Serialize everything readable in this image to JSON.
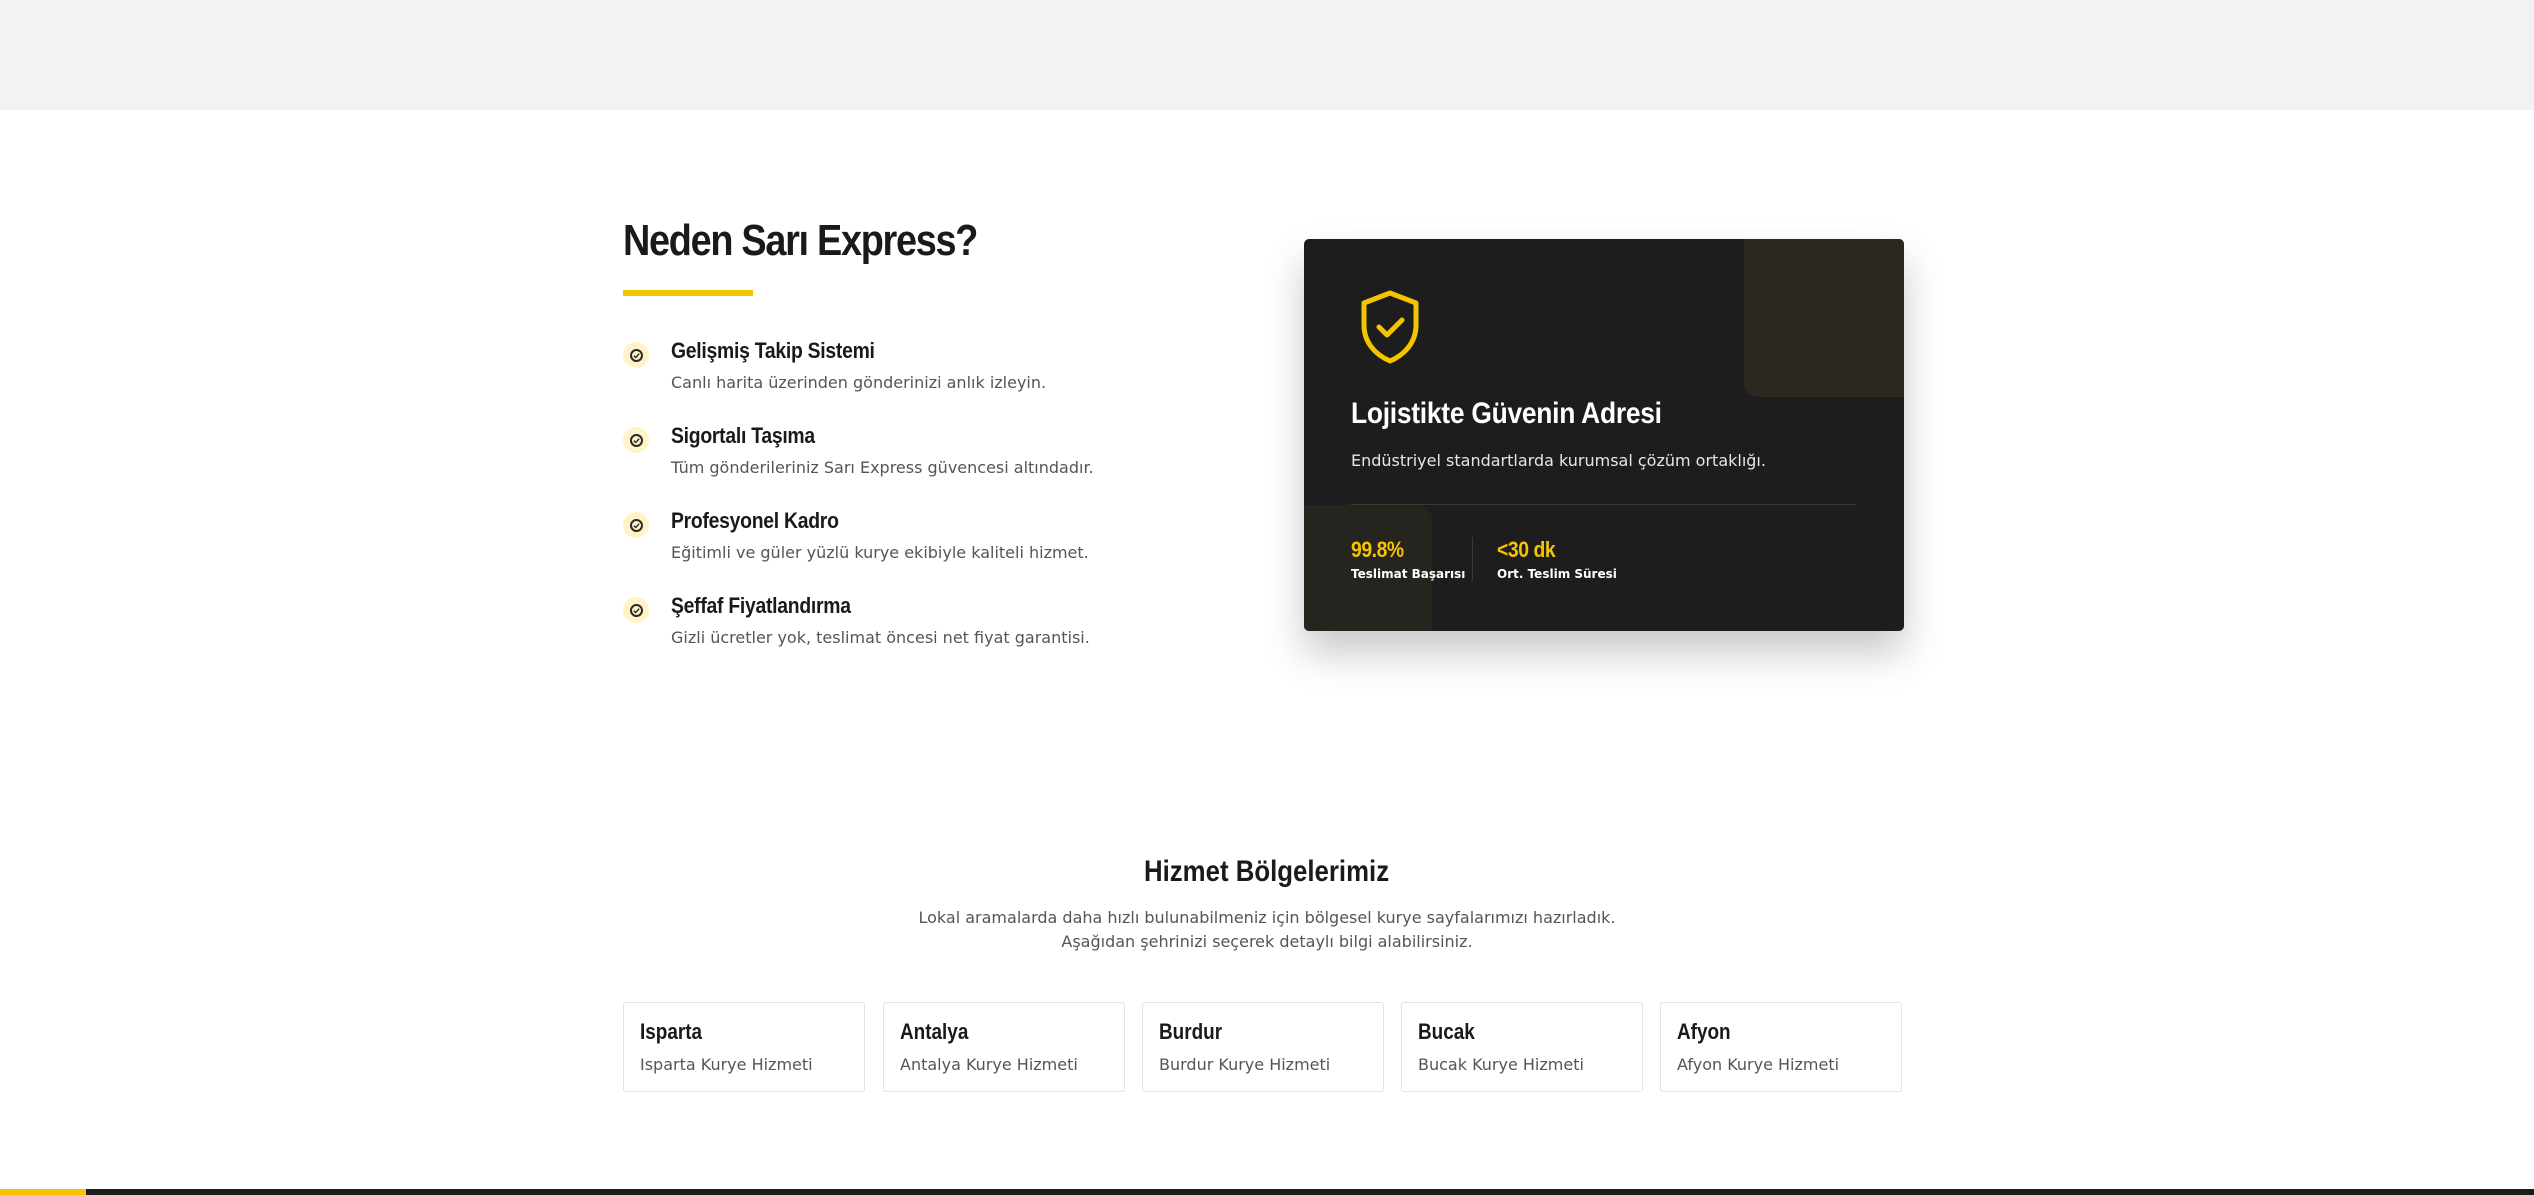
{
  "why": {
    "title": "Neden Sarı Express?",
    "features": [
      {
        "title": "Gelişmiş Takip Sistemi",
        "desc": "Canlı harita üzerinden gönderinizi anlık izleyin."
      },
      {
        "title": "Sigortalı Taşıma",
        "desc": "Tüm gönderileriniz Sarı Express güvencesi altındadır."
      },
      {
        "title": "Profesyonel Kadro",
        "desc": "Eğitimli ve güler yüzlü kurye ekibiyle kaliteli hizmet."
      },
      {
        "title": "Şeffaf Fiyatlandırma",
        "desc": "Gizli ücretler yok, teslimat öncesi net fiyat garantisi."
      }
    ]
  },
  "trust_card": {
    "icon": "shield-check-icon",
    "title": "Lojistikte Güvenin Adresi",
    "subtitle": "Endüstriyel standartlarda kurumsal çözüm ortaklığı.",
    "stats": [
      {
        "value": "99.8%",
        "label": "Teslimat Başarısı"
      },
      {
        "value": "<30 dk",
        "label": "Ort. Teslim Süresi"
      }
    ]
  },
  "regions": {
    "title": "Hizmet Bölgelerimiz",
    "description": "Lokal aramalarda daha hızlı bulunabilmeniz için bölgesel kurye sayfalarımızı hazırladık. Aşağıdan şehrinizi seçerek detaylı bilgi alabilirsiniz.",
    "items": [
      {
        "name": "Isparta",
        "service": "Isparta Kurye Hizmeti"
      },
      {
        "name": "Antalya",
        "service": "Antalya Kurye Hizmeti"
      },
      {
        "name": "Burdur",
        "service": "Burdur Kurye Hizmeti"
      },
      {
        "name": "Bucak",
        "service": "Bucak Kurye Hizmeti"
      },
      {
        "name": "Afyon",
        "service": "Afyon Kurye Hizmeti"
      }
    ]
  },
  "colors": {
    "accent": "#f5c400",
    "dark_card": "#1c1d1c",
    "page_band": "#f2f2f2"
  }
}
